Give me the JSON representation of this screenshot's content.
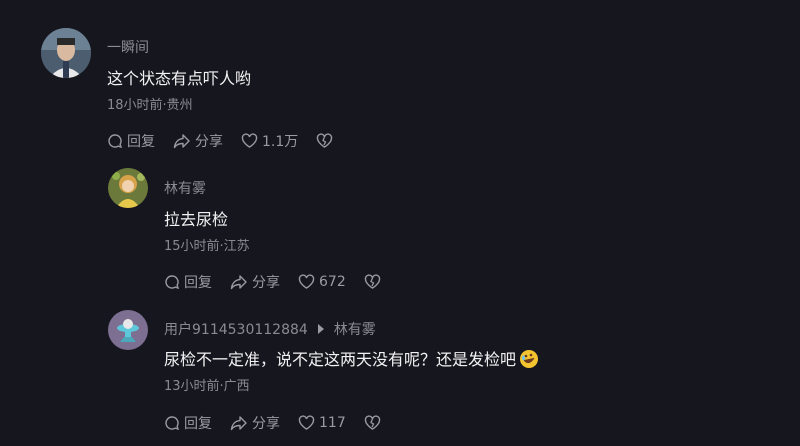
{
  "comments": [
    {
      "username": "一瞬间",
      "content": "这个状态有点吓人哟",
      "meta": "18小时前·贵州",
      "reply_label": "回复",
      "share_label": "分享",
      "likes": "1.1万"
    },
    {
      "username": "林有雾",
      "content": "拉去尿检",
      "meta": "15小时前·江苏",
      "reply_label": "回复",
      "share_label": "分享",
      "likes": "672"
    },
    {
      "username": "用户9114530112884",
      "reply_to": "林有雾",
      "content": "尿检不一定准，说不定这两天没有呢？还是发检吧",
      "emoji": "rolling-on-floor-laughing-emoji",
      "meta": "13小时前·广西",
      "reply_label": "回复",
      "share_label": "分享",
      "likes": "117"
    }
  ],
  "colors": {
    "background": "#16161e",
    "text_primary": "#f2f2f4",
    "text_secondary": "#8a8b92"
  }
}
